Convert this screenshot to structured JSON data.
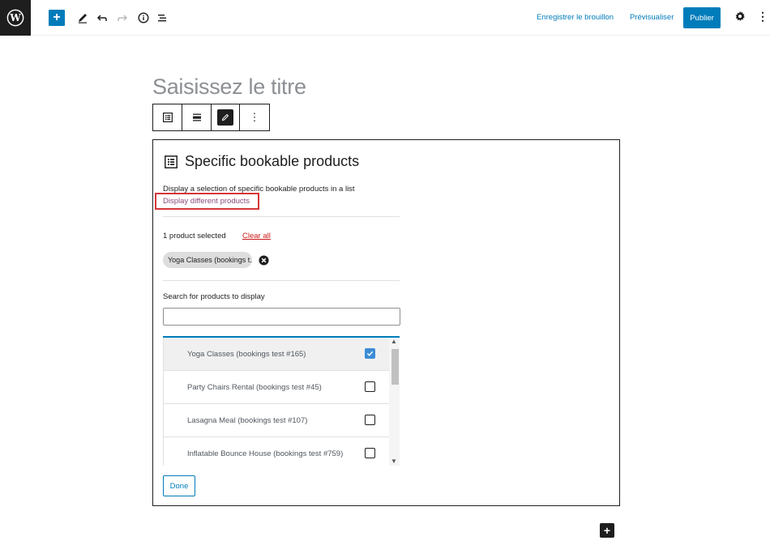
{
  "topbar": {
    "save_draft": "Enregistrer le brouillon",
    "preview": "Prévisualiser",
    "publish": "Publier",
    "more": "⋮"
  },
  "post": {
    "title_placeholder": "Saisissez le titre"
  },
  "block": {
    "title": "Specific bookable products",
    "description": "Display a selection of specific bookable products in a list",
    "display_different": "Display different products",
    "selected_count": "1 product selected",
    "clear_all": "Clear all",
    "selected_chip": "Yoga Classes (bookings t...",
    "search_label": "Search for products to display",
    "search_value": "",
    "products": [
      {
        "label": "Yoga Classes (bookings test #165)",
        "checked": true
      },
      {
        "label": "Party Chairs Rental (bookings test #45)",
        "checked": false
      },
      {
        "label": "Lasagna Meal (bookings test #107)",
        "checked": false
      },
      {
        "label": "Inflatable Bounce House (bookings test #759)",
        "checked": false
      }
    ],
    "done": "Done"
  },
  "colors": {
    "accent": "#007cba",
    "dark": "#1e1e1e",
    "highlight_border": "#d63638",
    "clear_all": "#cc1818"
  }
}
